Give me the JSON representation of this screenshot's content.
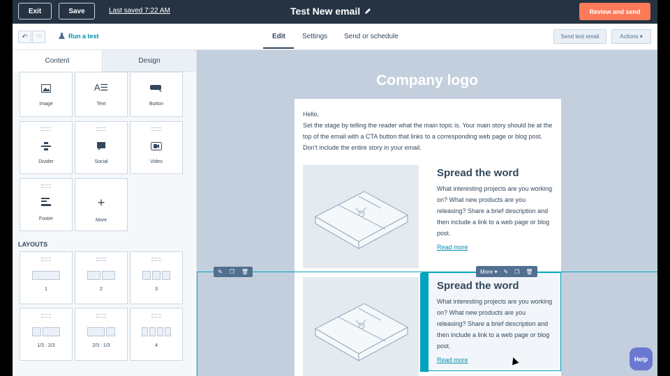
{
  "topbar": {
    "exit_label": "Exit",
    "save_label": "Save",
    "last_saved": "Last saved 7:22 AM",
    "email_title": "Test New email",
    "review_label": "Review and send"
  },
  "subbar": {
    "run_test_label": "Run a test",
    "tabs": [
      {
        "label": "Edit",
        "active": true
      },
      {
        "label": "Settings",
        "active": false
      },
      {
        "label": "Send or schedule",
        "active": false
      }
    ],
    "send_test_label": "Send test email",
    "actions_label": "Actions ▾"
  },
  "left_panel": {
    "tabs": [
      "Content",
      "Design"
    ],
    "modules": [
      "Image",
      "Text",
      "Button",
      "Divider",
      "Social",
      "Video",
      "Footer",
      "More"
    ],
    "layouts_heading": "LAYOUTS",
    "layouts": [
      "1",
      "2",
      "3",
      "1/3 : 2/3",
      "2/3 : 1/3",
      "4"
    ]
  },
  "email": {
    "logo_text": "Company logo",
    "greeting": "Hello,",
    "intro": "Set the stage by telling the reader what the main topic is. Your main story should be at the top of the email with a CTA button that links to a corresponding web page or blog post. Don't include the entire story in your email.",
    "sections": [
      {
        "heading": "Spread the word",
        "body": "What interesting projects are you working on? What new products are you releasing? Share a brief description and then include a link to a web page or blog post.",
        "link": "Read more"
      },
      {
        "heading": "Spread the word",
        "body": "What interesting projects are you working on? What new products are you releasing? Share a brief description and then include a link to a web page or blog post.",
        "link": "Read more"
      }
    ],
    "module_toolbar_more": "More ▾"
  },
  "help_label": "Help",
  "colors": {
    "topbar": "#253342",
    "accent": "#ff7a59",
    "link": "#0091ae",
    "selection": "#00a4bd",
    "help": "#6a78d1"
  }
}
